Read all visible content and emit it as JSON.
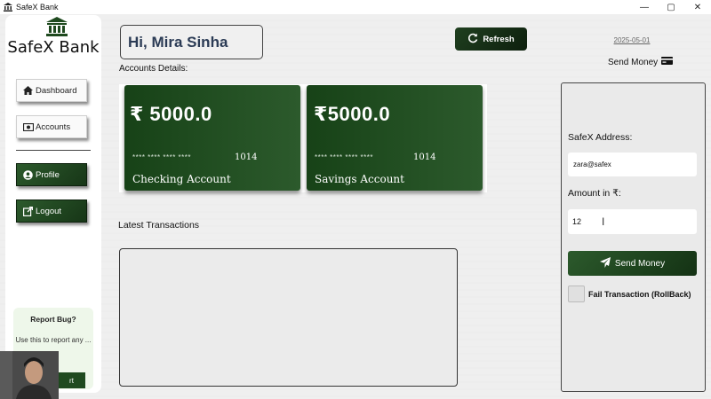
{
  "window": {
    "title": "SafeX Bank",
    "minimize": "—",
    "maximize": "▢",
    "close": "✕"
  },
  "sidebar": {
    "logo_text": "SafeX Bank",
    "items": [
      {
        "label": "Dashboard",
        "icon": "home-icon"
      },
      {
        "label": "Accounts",
        "icon": "money-icon"
      },
      {
        "label": "Profile",
        "icon": "user-icon"
      },
      {
        "label": "Logout",
        "icon": "external-link-icon"
      }
    ],
    "bug_report": {
      "title": "Report Bug?",
      "description": "Use this to report any ...",
      "button_label": "rt"
    }
  },
  "header": {
    "greeting": "Hi, Mira Sinha",
    "refresh_label": "Refresh",
    "date": "2025-05-01",
    "send_money_label": "Send Money"
  },
  "accounts": {
    "section_label": "Accounts Details:",
    "cards": [
      {
        "balance": "₹ 5000.0",
        "masked_number": "**** **** **** ****",
        "last4": "1014",
        "type": "Checking Account"
      },
      {
        "balance": "₹5000.0",
        "masked_number": "**** **** **** ****",
        "last4": "1014",
        "type": "Savings Account"
      }
    ]
  },
  "transactions": {
    "label": "Latest Transactions"
  },
  "send_form": {
    "address_label": "SafeX Address:",
    "address_value": "zara@safex",
    "amount_label": "Amount in ₹:",
    "amount_value": "12",
    "send_label": "Send Money",
    "fail_label": "Fail Transaction (RollBack)"
  },
  "colors": {
    "brand_green": "#1f4a1f",
    "greeting_text": "#2b3b55"
  }
}
